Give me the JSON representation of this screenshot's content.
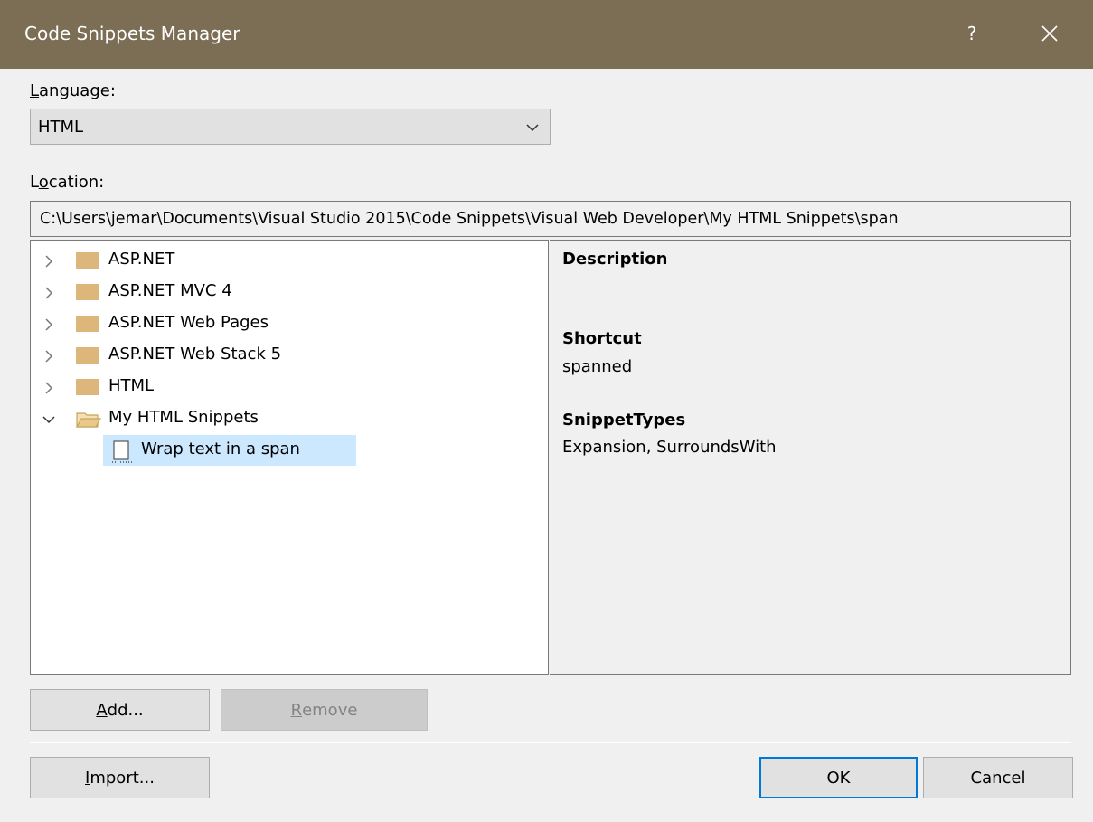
{
  "window": {
    "title": "Code Snippets Manager",
    "help_glyph": "?"
  },
  "language": {
    "label_accel": "L",
    "label_rest": "anguage:",
    "selected": "HTML"
  },
  "location": {
    "label_pre": "L",
    "label_accel": "o",
    "label_rest": "cation:",
    "path": "C:\\Users\\jemar\\Documents\\Visual Studio 2015\\Code Snippets\\Visual Web Developer\\My HTML Snippets\\span"
  },
  "tree": {
    "folders": [
      {
        "label": "ASP.NET",
        "expanded": false
      },
      {
        "label": "ASP.NET MVC 4",
        "expanded": false
      },
      {
        "label": "ASP.NET Web Pages",
        "expanded": false
      },
      {
        "label": "ASP.NET Web Stack 5",
        "expanded": false
      },
      {
        "label": "HTML",
        "expanded": false
      },
      {
        "label": "My HTML Snippets",
        "expanded": true
      }
    ],
    "selected_snippet": "Wrap text in a span"
  },
  "details": {
    "description_heading": "Description",
    "shortcut_heading": "Shortcut",
    "shortcut_value": "spanned",
    "types_heading": "SnippetTypes",
    "types_value": "Expansion, SurroundsWith"
  },
  "buttons": {
    "add_accel": "A",
    "add_rest": "dd...",
    "remove_accel": "R",
    "remove_rest": "emove",
    "import_accel": "I",
    "import_rest": "mport...",
    "ok": "OK",
    "cancel": "Cancel"
  },
  "colors": {
    "titlebar": "#7b6e55",
    "selection": "#cce8ff",
    "default_button_border": "#0078d7",
    "folder": "#dcb67a"
  }
}
